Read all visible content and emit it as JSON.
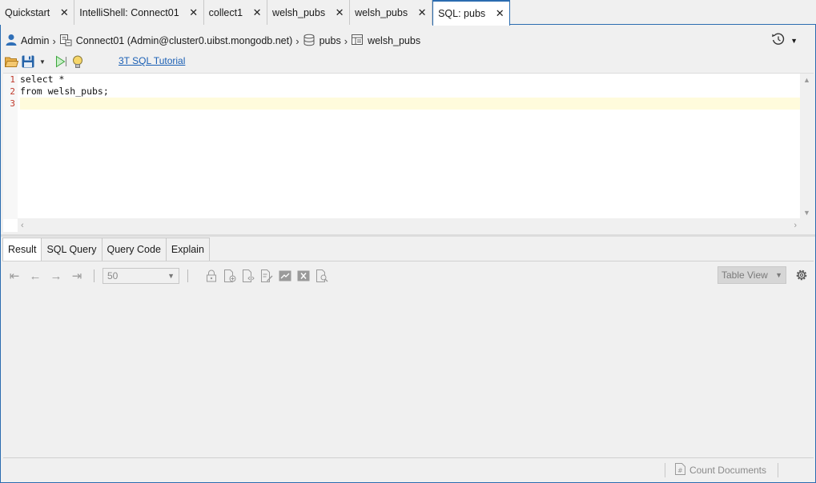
{
  "tabs": [
    {
      "label": "Quickstart",
      "active": false
    },
    {
      "label": "IntelliShell: Connect01",
      "active": false
    },
    {
      "label": "collect1",
      "active": false
    },
    {
      "label": "welsh_pubs",
      "active": false
    },
    {
      "label": "welsh_pubs",
      "active": false
    },
    {
      "label": "SQL: pubs",
      "active": true
    }
  ],
  "breadcrumb": {
    "user": "Admin",
    "connection": "Connect01 (Admin@cluster0.uibst.mongodb.net)",
    "database": "pubs",
    "collection": "welsh_pubs"
  },
  "toolbar": {
    "tutorial_link": "3T SQL Tutorial",
    "icons": [
      "open-folder-icon",
      "save-icon",
      "run-icon",
      "hint-bulb-icon"
    ]
  },
  "editor": {
    "lines": [
      {
        "number": "1",
        "text": "select *"
      },
      {
        "number": "2",
        "text": "from welsh_pubs;"
      },
      {
        "number": "3",
        "text": ""
      }
    ]
  },
  "results": {
    "tabs": [
      "Result",
      "SQL Query",
      "Query Code",
      "Explain"
    ],
    "active_tab": "Result",
    "page_size": "50",
    "view_mode": "Table View",
    "count_documents_label": "Count Documents"
  },
  "colors": {
    "accent": "#2b6cb0",
    "line_number": "#c0392b",
    "current_line": "#fffbdc",
    "link": "#1a5fb4"
  }
}
